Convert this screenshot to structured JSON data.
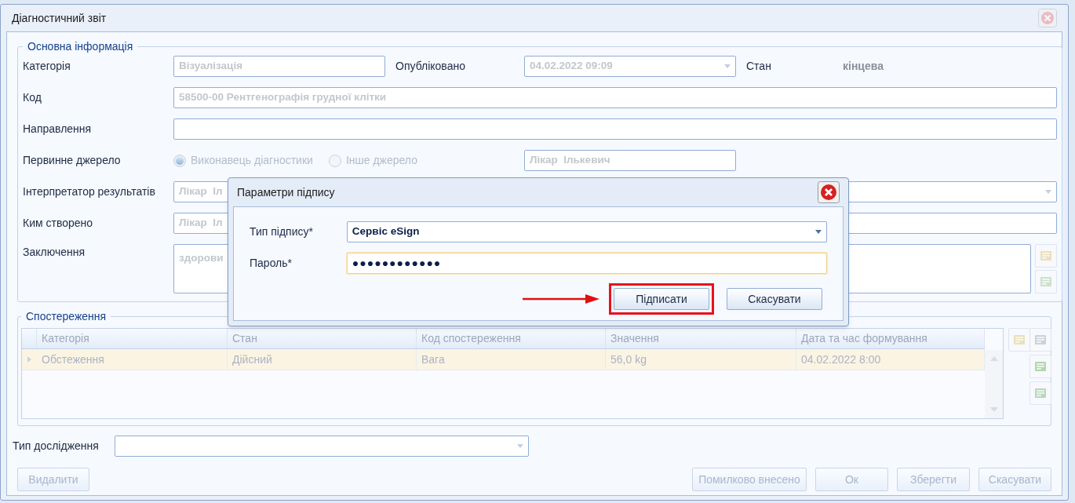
{
  "window": {
    "title": "Діагностичний звіт"
  },
  "main_info": {
    "title": "Основна інформація",
    "category": {
      "label": "Категорія",
      "value": "Візуалізація"
    },
    "published": {
      "label": "Опубліковано",
      "value": "04.02.2022 09:09"
    },
    "state": {
      "label": "Стан",
      "value": "кінцева"
    },
    "code": {
      "label": "Код",
      "value": "58500-00 Рентгенографія грудної клітки"
    },
    "referral": {
      "label": "Направлення"
    },
    "primary_source": {
      "label": "Первинне джерело",
      "value": "Лікар  Ількевич",
      "options": [
        {
          "label": "Виконавець діагностики",
          "selected": true
        },
        {
          "label": "Інше джерело",
          "selected": false
        }
      ]
    },
    "interpreter": {
      "label": "Інтерпретатор результатів",
      "value": "Лікар  Іл"
    },
    "created_by": {
      "label": "Ким створено",
      "value": "Лікар  Іл"
    },
    "conclusion": {
      "label": "Заключення",
      "value": "здорови"
    }
  },
  "observations": {
    "title": "Спостереження",
    "columns": [
      "Категорія",
      "Стан",
      "Код спостереження",
      "Значення",
      "Дата та час формування"
    ],
    "rows": [
      {
        "cells": [
          "Обстеження",
          "Дійсний",
          "Вага",
          "56,0 kg",
          "04.02.2022 8:00"
        ],
        "selected": true
      }
    ]
  },
  "study_type": {
    "label": "Тип дослідження"
  },
  "buttons_left": [
    {
      "label": "Видалити",
      "disabled": true
    }
  ],
  "buttons_right": [
    {
      "label": "Помилково внесено",
      "disabled": true
    },
    {
      "label": "Ок",
      "disabled": true
    },
    {
      "label": "Зберегти",
      "disabled": true
    },
    {
      "label": "Скасувати",
      "disabled": true
    }
  ],
  "signature_dialog": {
    "title": "Параметри підпису",
    "signature_type": {
      "label": "Тип підпису*",
      "value": "Сервіс eSign"
    },
    "password": {
      "label": "Пароль*",
      "value": "●●●●●●●●●●●●",
      "focused": true
    },
    "buttons": [
      {
        "label": "Підписати",
        "highlighted": true
      },
      {
        "label": "Скасувати",
        "highlighted": false
      }
    ]
  }
}
